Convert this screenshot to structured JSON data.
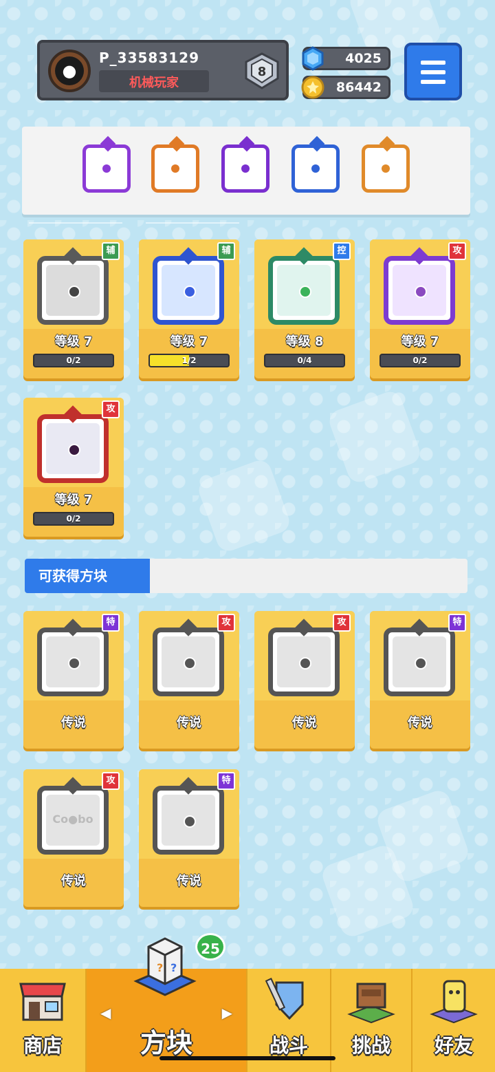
{
  "header": {
    "player_id": "P_33583129",
    "player_title": "机械玩家",
    "rank": "8",
    "gems": "4025",
    "coins": "86442"
  },
  "equipped": [
    {
      "icon": "purple-rune-dice-icon",
      "color": "#8b3ad6"
    },
    {
      "icon": "orange-dice-icon",
      "color": "#e07a26"
    },
    {
      "icon": "purple-moon-dice-icon",
      "color": "#7a2fcf"
    },
    {
      "icon": "snowflake-dice-icon",
      "color": "#2f62d6"
    },
    {
      "icon": "infinity-dice-icon",
      "color": "#e08a2a"
    }
  ],
  "owned_dice": [
    {
      "tag": "辅",
      "tag_color": "#3c9b52",
      "frame_color": "#5a5a5a",
      "inner": "#dcdcdc",
      "dot": "#444",
      "level": "等级 7",
      "progress": "0/2",
      "fill": 0.0
    },
    {
      "tag": "辅",
      "tag_color": "#3c9b52",
      "frame_color": "#2f55d0",
      "inner": "#d7e6ff",
      "dot": "#3a5fe0",
      "level": "等级 7",
      "progress": "1/2",
      "fill": 0.5
    },
    {
      "tag": "控",
      "tag_color": "#2f7bea",
      "frame_color": "#2d8a66",
      "inner": "#e0f4ee",
      "dot": "#3bb35a",
      "level": "等级 8",
      "progress": "0/4",
      "fill": 0.0
    },
    {
      "tag": "攻",
      "tag_color": "#e0333a",
      "frame_color": "#7d3bd1",
      "inner": "#efe3ff",
      "dot": "#8b4ac0",
      "level": "等级 7",
      "progress": "0/2",
      "fill": 0.0
    },
    {
      "tag": "攻",
      "tag_color": "#e0333a",
      "frame_color": "#c0302c",
      "inner": "#e9e9f3",
      "dot": "#3a1a40",
      "level": "等级 7",
      "progress": "0/2",
      "fill": 0.0
    }
  ],
  "section_title": "可获得方块",
  "available_dice": [
    {
      "tag": "特",
      "tag_color": "#7d33d6",
      "rarity": "传说",
      "icon": "pentagram-dice-icon"
    },
    {
      "tag": "攻",
      "tag_color": "#e0333a",
      "rarity": "传说",
      "icon": "sun-dice-icon"
    },
    {
      "tag": "攻",
      "tag_color": "#e0333a",
      "rarity": "传说",
      "icon": "vortex-dice-icon"
    },
    {
      "tag": "特",
      "tag_color": "#7d33d6",
      "rarity": "传说",
      "icon": "flame-dice-icon"
    },
    {
      "tag": "攻",
      "tag_color": "#e0333a",
      "rarity": "传说",
      "icon": "combo-dice-icon",
      "text": "Co●bo"
    },
    {
      "tag": "特",
      "tag_color": "#7d33d6",
      "rarity": "传说",
      "icon": "eye-dice-icon"
    }
  ],
  "nav": {
    "shop": "商店",
    "dice": "方块",
    "battle": "战斗",
    "challenge": "挑战",
    "friends": "好友",
    "badge": "25"
  }
}
